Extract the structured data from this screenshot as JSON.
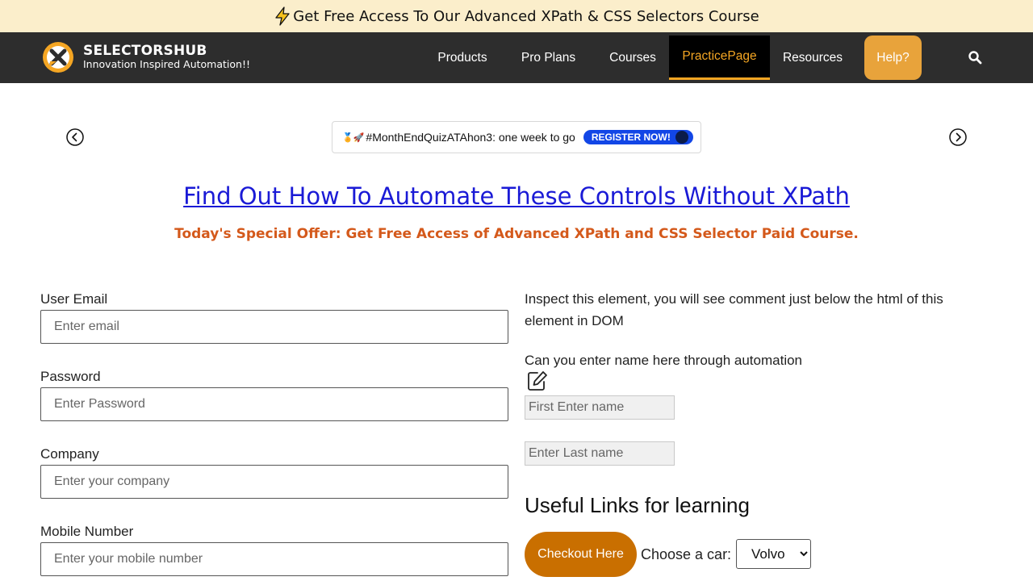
{
  "promo": {
    "text": "Get Free Access To Our Advanced XPath & CSS Selectors Course",
    "icon": "lightning-icon"
  },
  "brand": {
    "name": "SELECTORSHUB",
    "tagline": "Innovation Inspired Automation!!"
  },
  "nav": {
    "products": "Products",
    "pro_plans": "Pro Plans",
    "courses": "Courses",
    "practice_page": "PracticePage",
    "resources": "Resources",
    "help": "Help?",
    "active": "PracticePage"
  },
  "ticker": {
    "text": "#MonthEndQuizATAhon3: one week to go",
    "button": "REGISTER NOW!"
  },
  "headline": "Find Out How To Automate These Controls Without XPath",
  "offer": "Today's Special Offer: Get Free Access of Advanced XPath and CSS Selector Paid Course.",
  "form": {
    "email_label": "User Email",
    "email_placeholder": "Enter email",
    "password_label": "Password",
    "password_placeholder": "Enter Password",
    "company_label": "Company",
    "company_placeholder": "Enter your company",
    "mobile_label": "Mobile Number",
    "mobile_placeholder": "Enter your mobile number"
  },
  "right": {
    "inspect_text": "Inspect this element, you will see comment just below the html of this element in DOM",
    "name_question": "Can you enter name here through automation",
    "first_name_placeholder": "First Enter name",
    "last_name_placeholder": "Enter Last name",
    "useful_heading": "Useful Links for learning",
    "checkout_button": "Checkout Here",
    "car_label": "Choose a car:",
    "car_selected": "Volvo"
  },
  "colors": {
    "accent": "#f5a623",
    "nav_bg": "#2d2d2d",
    "link": "#1a1ad6",
    "offer": "#d4591b",
    "checkout": "#c96f00"
  }
}
